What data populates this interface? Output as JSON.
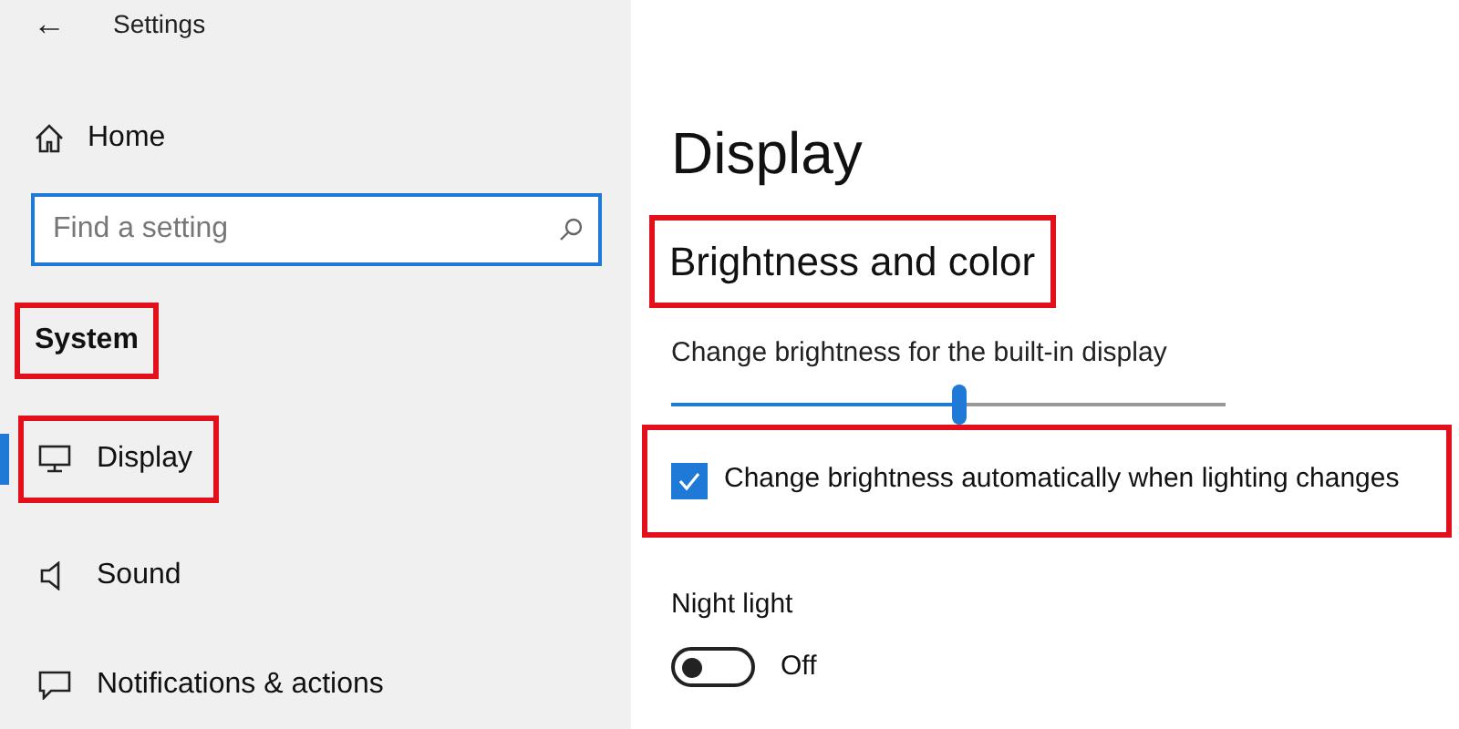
{
  "window": {
    "title": "Settings",
    "back": "←"
  },
  "sidebar": {
    "home": "Home",
    "search": {
      "placeholder": "Find a setting"
    },
    "section": {
      "label": "System",
      "highlighted": true
    },
    "items": [
      {
        "label": "Display",
        "selected": true,
        "highlighted": true,
        "kind": "monitor"
      },
      {
        "label": "Sound",
        "selected": false,
        "highlighted": false,
        "kind": "speaker"
      },
      {
        "label": "Notifications & actions",
        "selected": false,
        "highlighted": false,
        "kind": "message"
      }
    ]
  },
  "content": {
    "title": "Display",
    "section": {
      "label": "Brightness and color",
      "highlighted": true
    },
    "brightness": {
      "label": "Change brightness for the built-in display",
      "level": 0.52
    },
    "auto_brightness": {
      "label": "Change brightness automatically when lighting changes",
      "checked": true,
      "highlighted": true
    },
    "night_light": {
      "label": "Night light",
      "on": false,
      "state": "Off"
    }
  }
}
